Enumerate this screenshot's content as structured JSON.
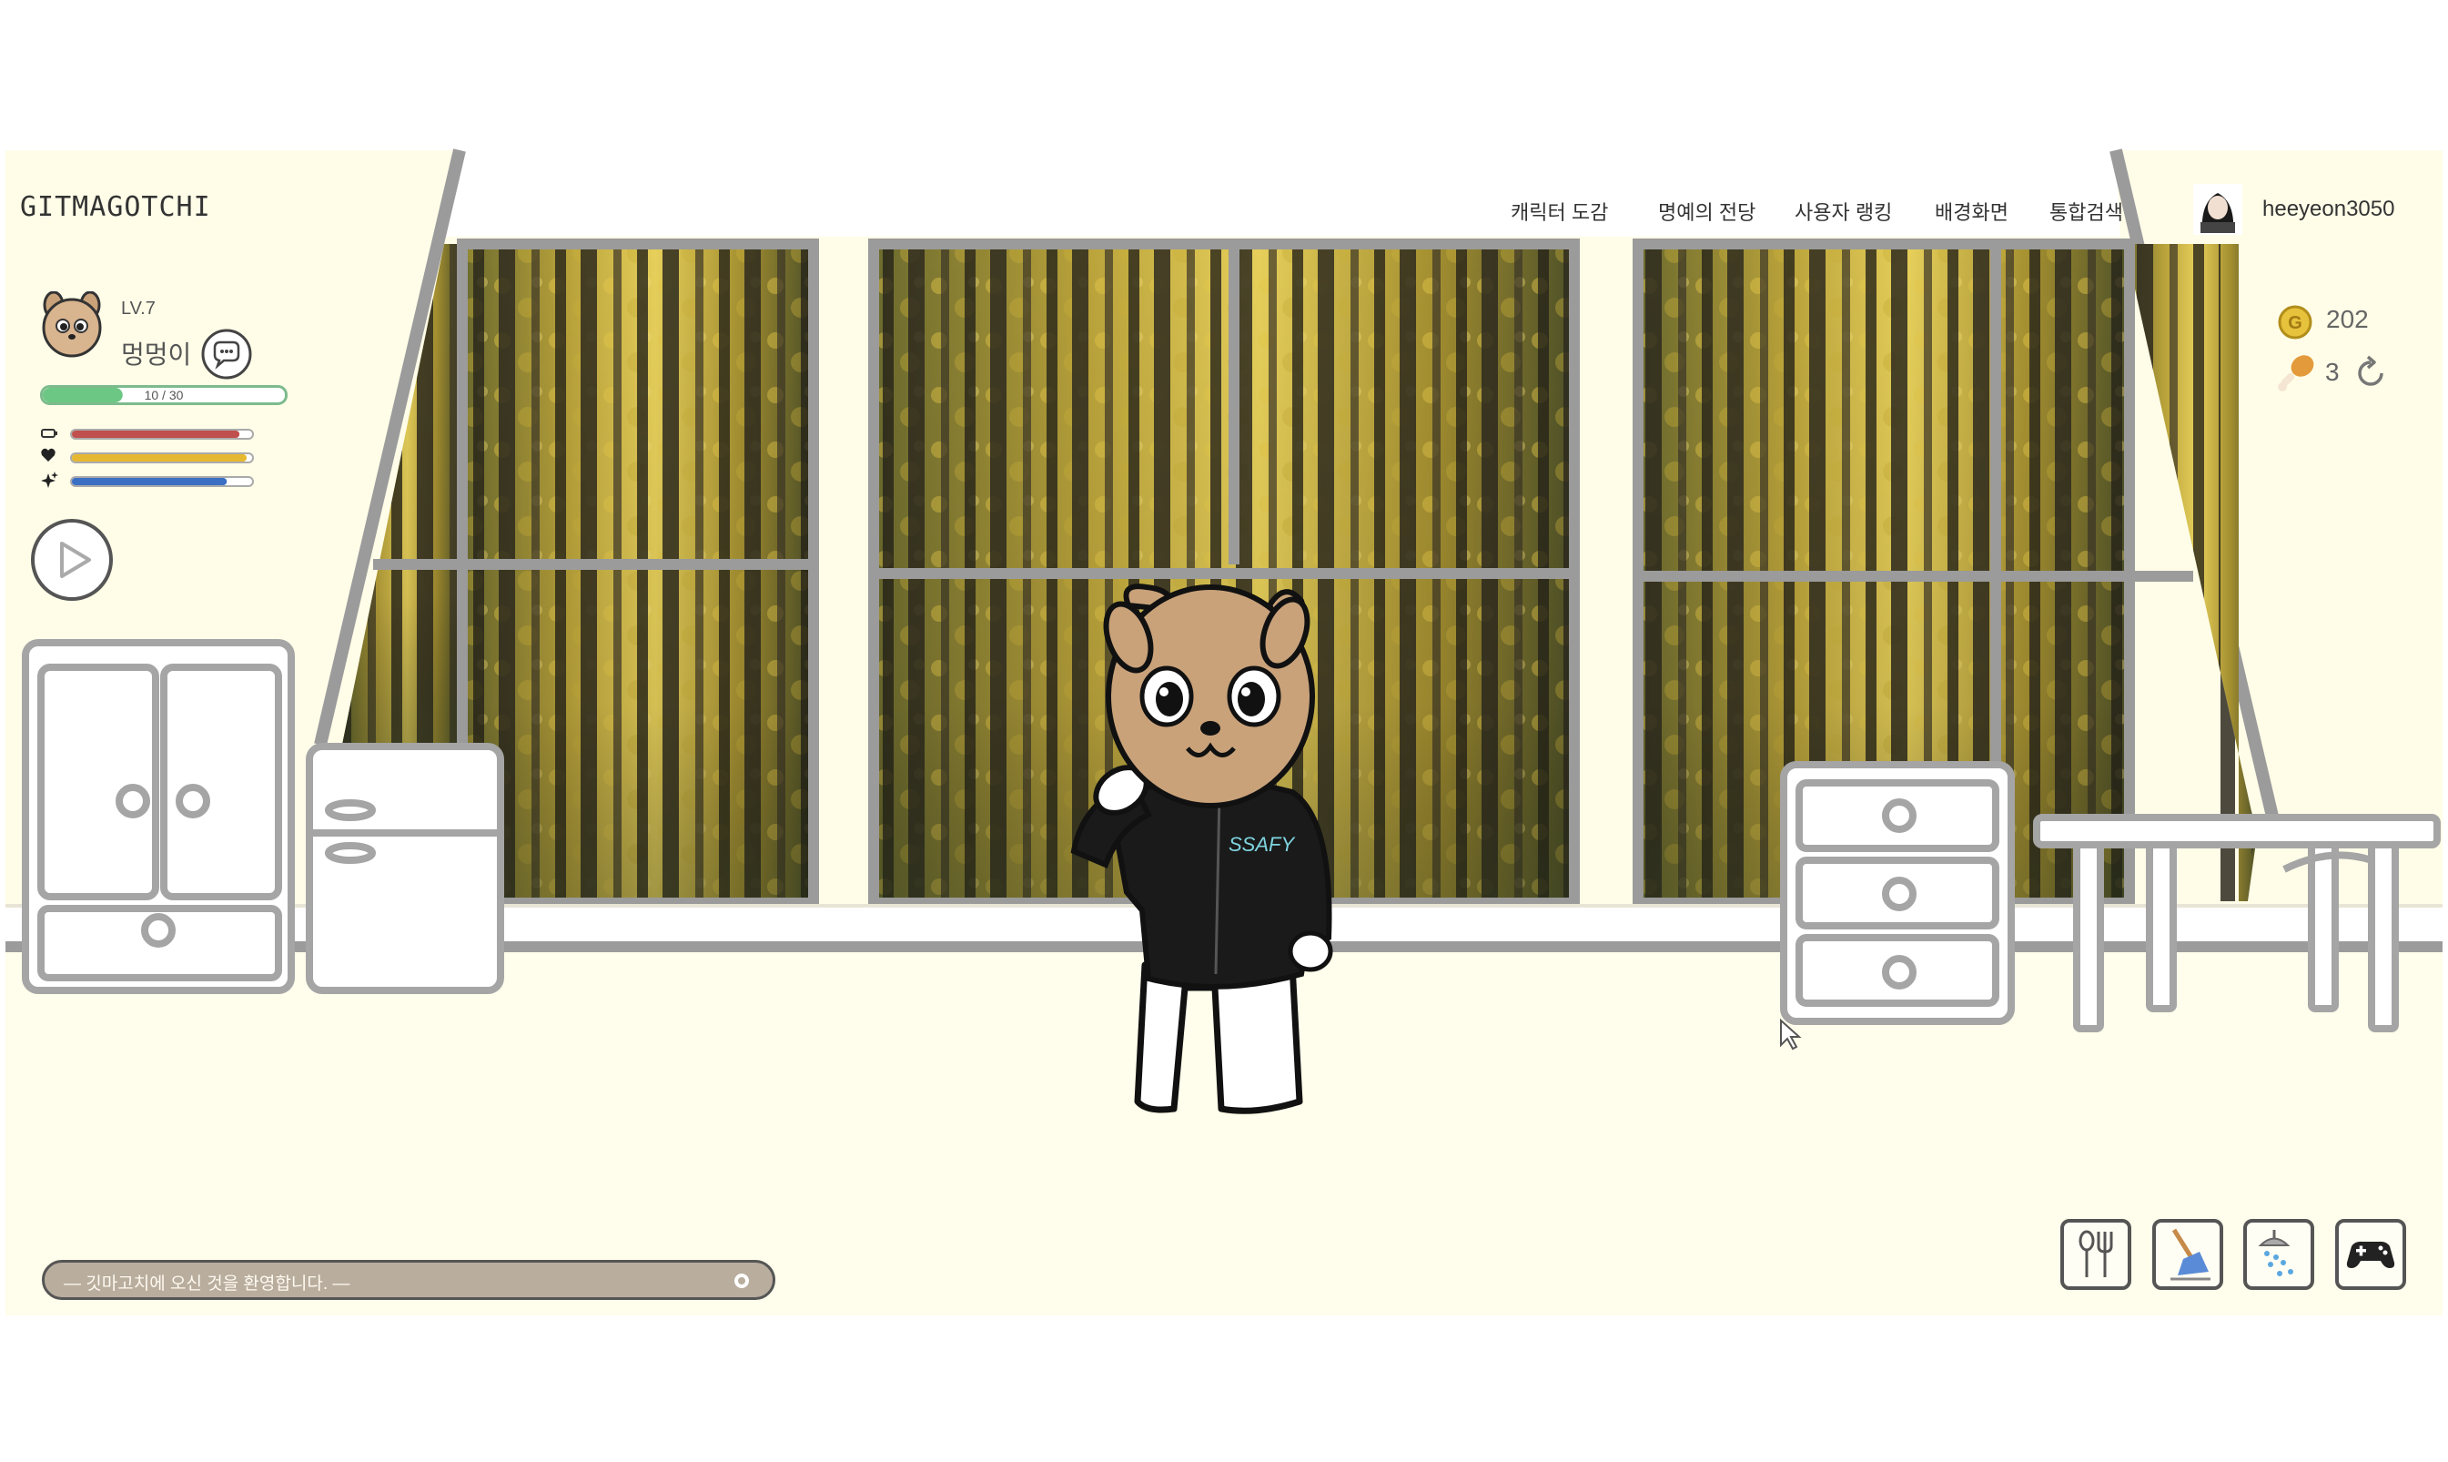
{
  "app": {
    "title": "GITMAGOTCHI"
  },
  "nav": {
    "items": [
      "캐릭터 도감",
      "명예의 전당",
      "사용자 랭킹",
      "배경화면",
      "통합검색"
    ]
  },
  "user": {
    "name": "heeyeon3050",
    "avatar_icon": "user-avatar"
  },
  "pet": {
    "level": "LV.7",
    "name": "멍멍이",
    "exp_text": "10 / 30",
    "exp_fraction": 0.33,
    "stats": [
      {
        "icon": "battery-icon",
        "value": 0.93,
        "color": "#c0504d"
      },
      {
        "icon": "heart-icon",
        "value": 0.97,
        "color": "#e6b830"
      },
      {
        "icon": "sparkle-icon",
        "value": 0.86,
        "color": "#3b6fc4"
      }
    ],
    "speech_icon": "speech-bubble-icon",
    "play_icon": "play-icon"
  },
  "currency": {
    "gold": "202",
    "food": "3",
    "gold_icon": "coin-icon",
    "food_icon": "drumstick-icon",
    "refresh_icon": "refresh-icon"
  },
  "message": {
    "text": "— 깃마고치에 오신 것을 환영합니다. —",
    "close_icon": "close-dot-icon"
  },
  "actions": [
    {
      "name": "feed",
      "icon": "spoon-fork-icon"
    },
    {
      "name": "clean",
      "icon": "broom-icon"
    },
    {
      "name": "wash",
      "icon": "shower-icon"
    },
    {
      "name": "play",
      "icon": "gamepad-icon"
    }
  ],
  "character": {
    "shirt_text": "SSAFY"
  },
  "colors": {
    "room_wall": "#fffde8",
    "floor": "#fffdeb",
    "outline": "#9b9b9b",
    "exp_bar": "#6cc784",
    "message_bar": "#b9ad9e"
  }
}
